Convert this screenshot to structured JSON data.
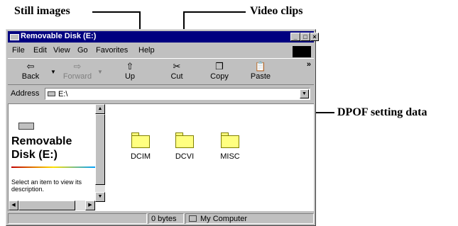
{
  "callouts": {
    "still_images": "Still images",
    "video_clips": "Video clips",
    "dpof": "DPOF setting data"
  },
  "window": {
    "title": "Removable Disk (E:)",
    "controls": [
      "_",
      "□",
      "×"
    ]
  },
  "menu": [
    "File",
    "Edit",
    "View",
    "Go",
    "Favorites",
    "Help"
  ],
  "toolbar": [
    {
      "label": "Back",
      "icon": "⇦",
      "enabled": true
    },
    {
      "label": "Forward",
      "icon": "⇨",
      "enabled": false
    },
    {
      "label": "Up",
      "icon": "⇧",
      "enabled": true
    },
    {
      "label": "Cut",
      "icon": "✂",
      "enabled": true
    },
    {
      "label": "Copy",
      "icon": "❐",
      "enabled": true
    },
    {
      "label": "Paste",
      "icon": "📋",
      "enabled": true
    }
  ],
  "toolbar_more": "»",
  "address": {
    "label": "Address",
    "value": "E:\\"
  },
  "left_pane": {
    "title_line1": "Removable",
    "title_line2": "Disk (E:)",
    "hint": "Select an item to view its description."
  },
  "folders": [
    {
      "name": "DCIM"
    },
    {
      "name": "DCVI"
    },
    {
      "name": "MISC"
    }
  ],
  "status": {
    "size": "0 bytes",
    "zone": "My Computer"
  }
}
